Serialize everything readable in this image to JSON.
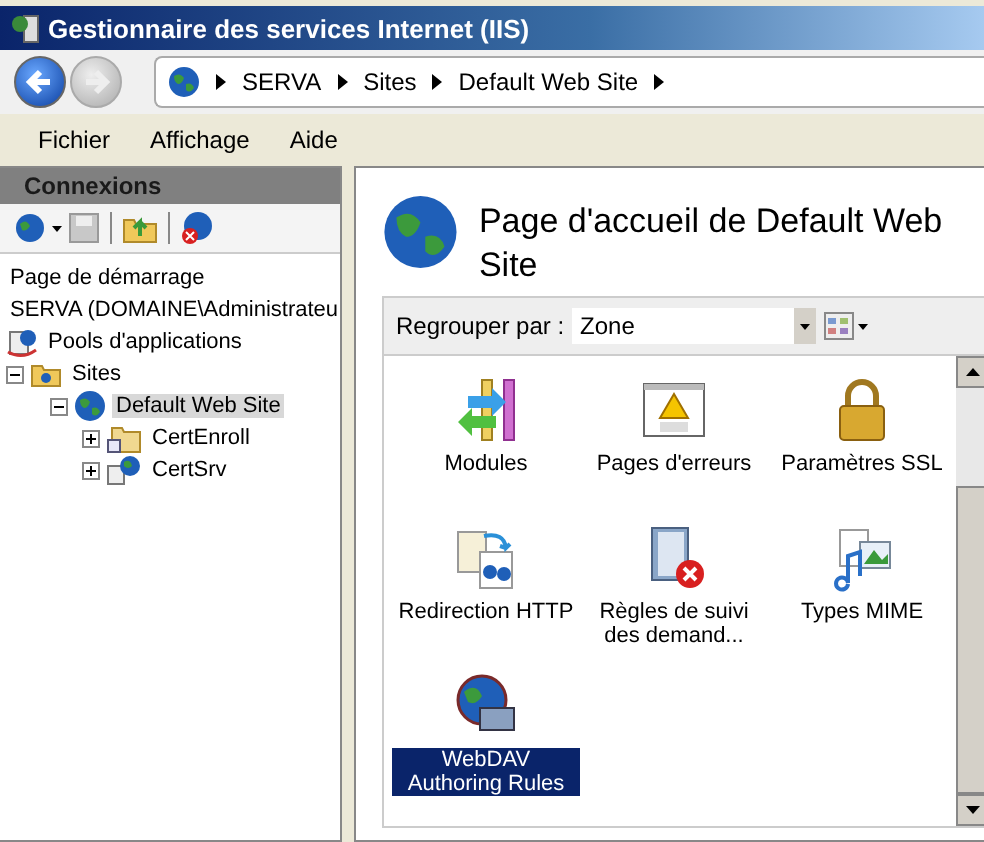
{
  "window": {
    "title": "Gestionnaire des services Internet (IIS)"
  },
  "breadcrumb": [
    "SERVA",
    "Sites",
    "Default Web Site"
  ],
  "menu": [
    "Fichier",
    "Affichage",
    "Aide"
  ],
  "connections": {
    "title": "Connexions",
    "tree": [
      {
        "label": "Page de démarrage",
        "kind": "text",
        "selected": false
      },
      {
        "label": "SERVA (DOMAINE\\Administrateu",
        "kind": "text",
        "selected": false
      },
      {
        "label": "Pools d'applications",
        "kind": "pools",
        "selected": false
      },
      {
        "label": "Sites",
        "kind": "folder",
        "selected": false,
        "expanded": true,
        "children": [
          {
            "label": "Default Web Site",
            "kind": "globe",
            "selected": true,
            "expanded": true,
            "children": [
              {
                "label": "CertEnroll",
                "kind": "vfolder",
                "selected": false,
                "expanded": false
              },
              {
                "label": "CertSrv",
                "kind": "app",
                "selected": false,
                "expanded": false
              }
            ]
          }
        ]
      }
    ]
  },
  "page": {
    "title": "Page d'accueil de Default Web Site",
    "group_by": {
      "label": "Regrouper par :",
      "value": "Zone"
    },
    "features": [
      {
        "label": "Modules",
        "kind": "modules",
        "selected": false
      },
      {
        "label": "Pages d'erreurs",
        "kind": "errors",
        "selected": false
      },
      {
        "label": "Paramètres SSL",
        "kind": "ssl",
        "selected": false
      },
      {
        "label": "Redirection HTTP",
        "kind": "redirect",
        "selected": false
      },
      {
        "label": "Règles de suivi des demand...",
        "kind": "tracing",
        "selected": false
      },
      {
        "label": "Types MIME",
        "kind": "mime",
        "selected": false
      },
      {
        "label": "WebDAV Authoring Rules",
        "kind": "webdav",
        "selected": true
      }
    ]
  }
}
